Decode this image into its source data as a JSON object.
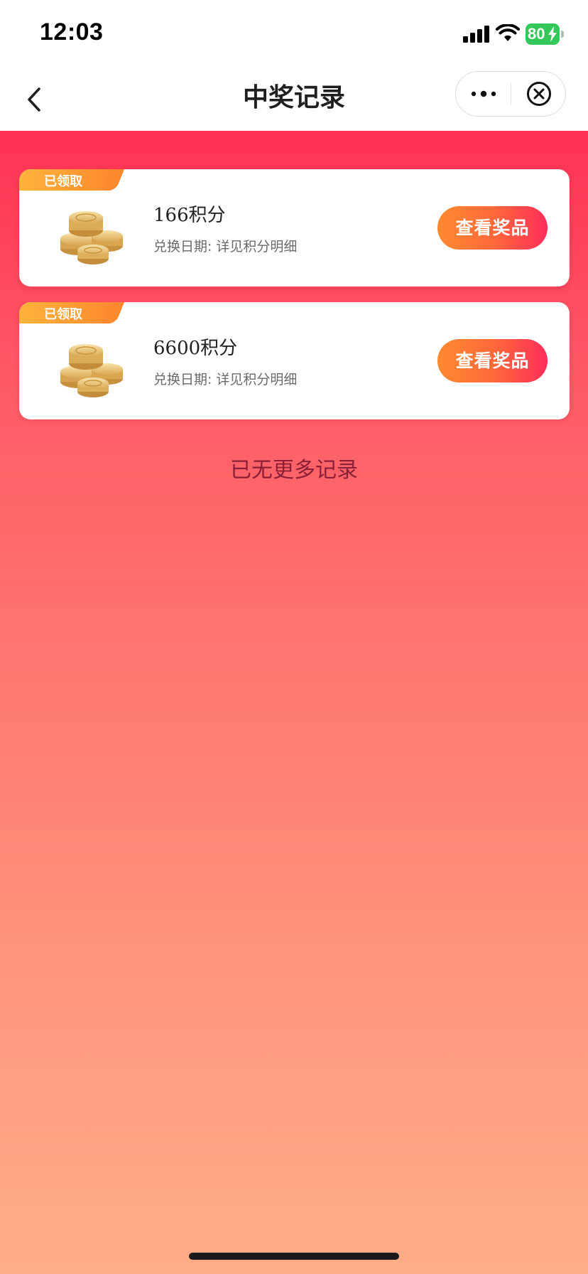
{
  "status_bar": {
    "time": "12:03",
    "battery_level": "80",
    "signal_bars": 4,
    "charging": true
  },
  "nav": {
    "title": "中奖记录",
    "back_icon": "chevron-left-icon",
    "more_icon": "more-dots-icon",
    "close_icon": "close-circle-icon"
  },
  "records": [
    {
      "status_tag": "已领取",
      "prize_name": "166积分",
      "date_label": "兑换日期:",
      "date_value": "详见积分明细",
      "button_label": "查看奖品",
      "image_icon": "gold-coins-icon"
    },
    {
      "status_tag": "已领取",
      "prize_name": "6600积分",
      "date_label": "兑换日期:",
      "date_value": "详见积分明细",
      "button_label": "查看奖品",
      "image_icon": "gold-coins-icon"
    }
  ],
  "footer": {
    "no_more_text": "已无更多记录"
  },
  "colors": {
    "header_red": "#ff3154",
    "background_bottom": "#ffae87",
    "button_orange": "#ff8a2f",
    "button_pink": "#ff2d5a",
    "tag_orange": "#ffb43c",
    "battery_green": "#34c759"
  }
}
